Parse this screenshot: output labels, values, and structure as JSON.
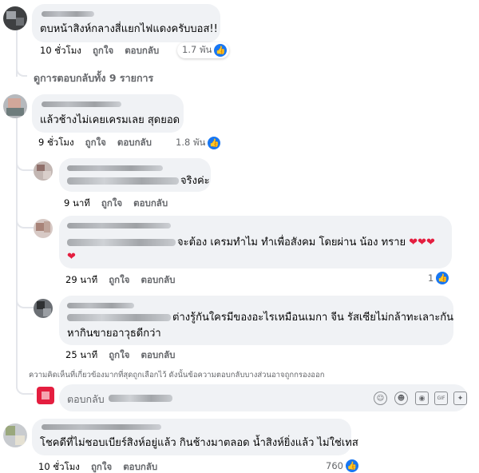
{
  "comments": [
    {
      "text": "ตบหน้าสิงห์กลางสี่แยกไฟแดงครับบอส!!",
      "time": "10 ชั่วโมง",
      "like_label": "ถูกใจ",
      "reply_label": "ตอบกลับ",
      "reactions": "1.7 พัน"
    },
    {
      "text": "แล้วช้างไม่เคยเครมเลย สุดยอด",
      "time": "9 ชั่วโมง",
      "like_label": "ถูกใจ",
      "reply_label": "ตอบกลับ",
      "reactions": "1.8 พัน"
    },
    {
      "text": "โชคดีที่ไม่ชอบเบียร์สิงห์อยู่แล้ว กินช้างมาตลอด น้ำสิงห์ยิ่งแล้ว ไม่ใช่เทส",
      "time": "10 ชั่วโมง",
      "like_label": "ถูกใจ",
      "reply_label": "ตอบกลับ",
      "reactions": "760"
    }
  ],
  "view_all_replies": "ดูการตอบกลับทั้ง 9 รายการ",
  "replies": [
    {
      "text": "จริงค่ะ",
      "time": "9 นาที",
      "like_label": "ถูกใจ",
      "reply_label": "ตอบกลับ"
    },
    {
      "text": "จะต้อง เครมทำไม ทำเพื่อสังคม โดยผ่าน น้อง ทราย",
      "time": "29 นาที",
      "like_label": "ถูกใจ",
      "reply_label": "ตอบกลับ",
      "reactions": "1"
    },
    {
      "text_line1": "ต่างรู้กันใครมีของอะไรเหมือนเมกา จีน รัสเซียไม่กล้าทะเลาะกัน",
      "text_line2": "หากินขายอาวุธดีกว่า",
      "time": "25 นาที",
      "like_label": "ถูกใจ",
      "reply_label": "ตอบกลับ"
    }
  ],
  "relevance_note": "ความคิดเห็นที่เกี่ยวข้องมากที่สุดถูกเลือกไว้ ดังนั้นข้อความตอบกลับบางส่วนอาจถูกกรองออก",
  "reply_box": {
    "placeholder": "ตอบกลับ"
  },
  "icons": {
    "like": "like-thumb-icon",
    "heart": "red-heart-emoji",
    "tools": [
      "sticker-icon",
      "emoji-icon",
      "camera-icon",
      "gif-icon",
      "avatar-sticker-icon"
    ]
  },
  "colors": {
    "like_blue": "#1877f2",
    "bubble_bg": "#f0f2f5",
    "meta_gray": "#65676b",
    "heart_red": "#e41e3f"
  }
}
